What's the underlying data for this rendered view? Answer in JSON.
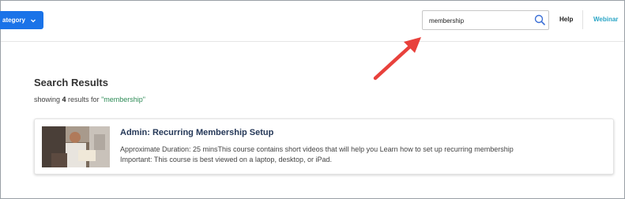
{
  "header": {
    "category_label": "ategory",
    "search": {
      "value": "membership",
      "placeholder": ""
    },
    "help_label": "Help",
    "webinar_label": "Webinar"
  },
  "results": {
    "title": "Search Results",
    "summary_prefix": "showing ",
    "summary_count": "4",
    "summary_middle": " results for ",
    "summary_query": "\"membership\""
  },
  "card": {
    "title": "Admin: Recurring Membership Setup",
    "description": "Approximate Duration: 25 minsThis course contains short videos that will help you Learn how to set up recurring membership Important: This course is best viewed on a laptop, desktop, or iPad."
  },
  "colors": {
    "accent": "#1a73e8",
    "webinar": "#2aa5c6",
    "query": "#2e8b57",
    "arrow": "#e8413c",
    "card_title": "#253858"
  },
  "icons": [
    "chevron-down-icon",
    "search-icon",
    "annotation-arrow"
  ]
}
